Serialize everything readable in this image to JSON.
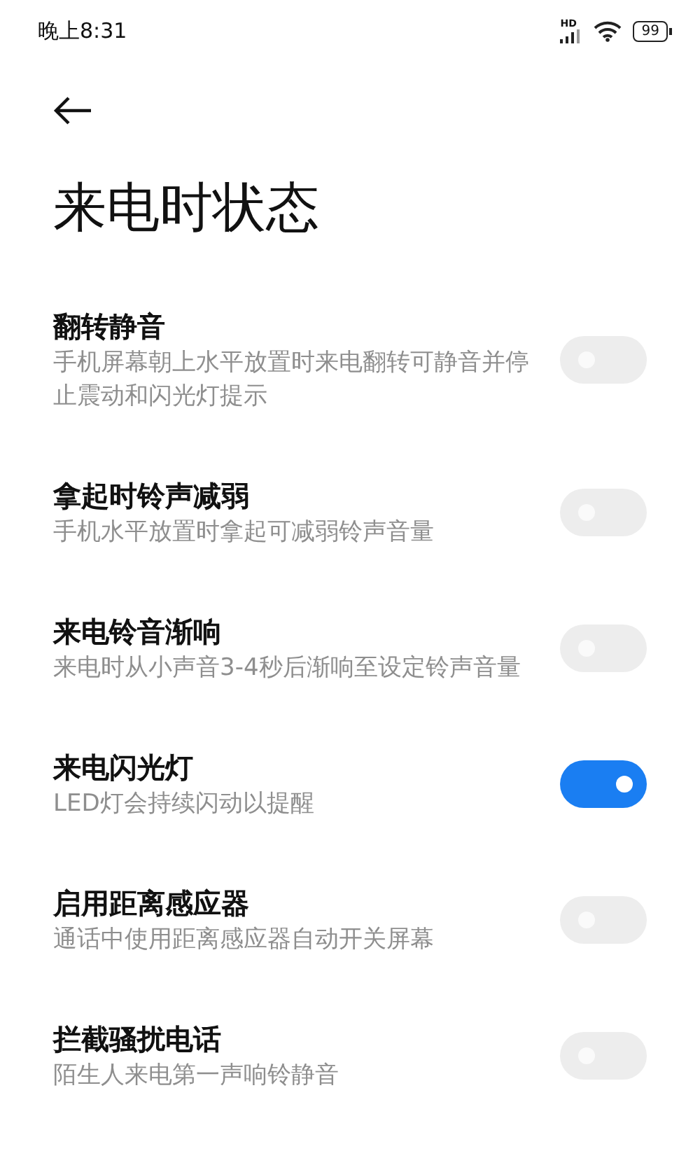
{
  "status_bar": {
    "time": "晚上8:31",
    "network_label": "HD",
    "battery": "99"
  },
  "header": {
    "title": "来电时状态"
  },
  "settings": [
    {
      "title": "翻转静音",
      "description": "手机屏幕朝上水平放置时来电翻转可静音并停止震动和闪光灯提示",
      "on": false
    },
    {
      "title": "拿起时铃声减弱",
      "description": "手机水平放置时拿起可减弱铃声音量",
      "on": false
    },
    {
      "title": "来电铃音渐响",
      "description": "来电时从小声音3-4秒后渐响至设定铃声音量",
      "on": false
    },
    {
      "title": "来电闪光灯",
      "description": "LED灯会持续闪动以提醒",
      "on": true
    },
    {
      "title": "启用距离感应器",
      "description": "通话中使用距离感应器自动开关屏幕",
      "on": false
    },
    {
      "title": "拦截骚扰电话",
      "description": "陌生人来电第一声响铃静音",
      "on": false
    }
  ]
}
